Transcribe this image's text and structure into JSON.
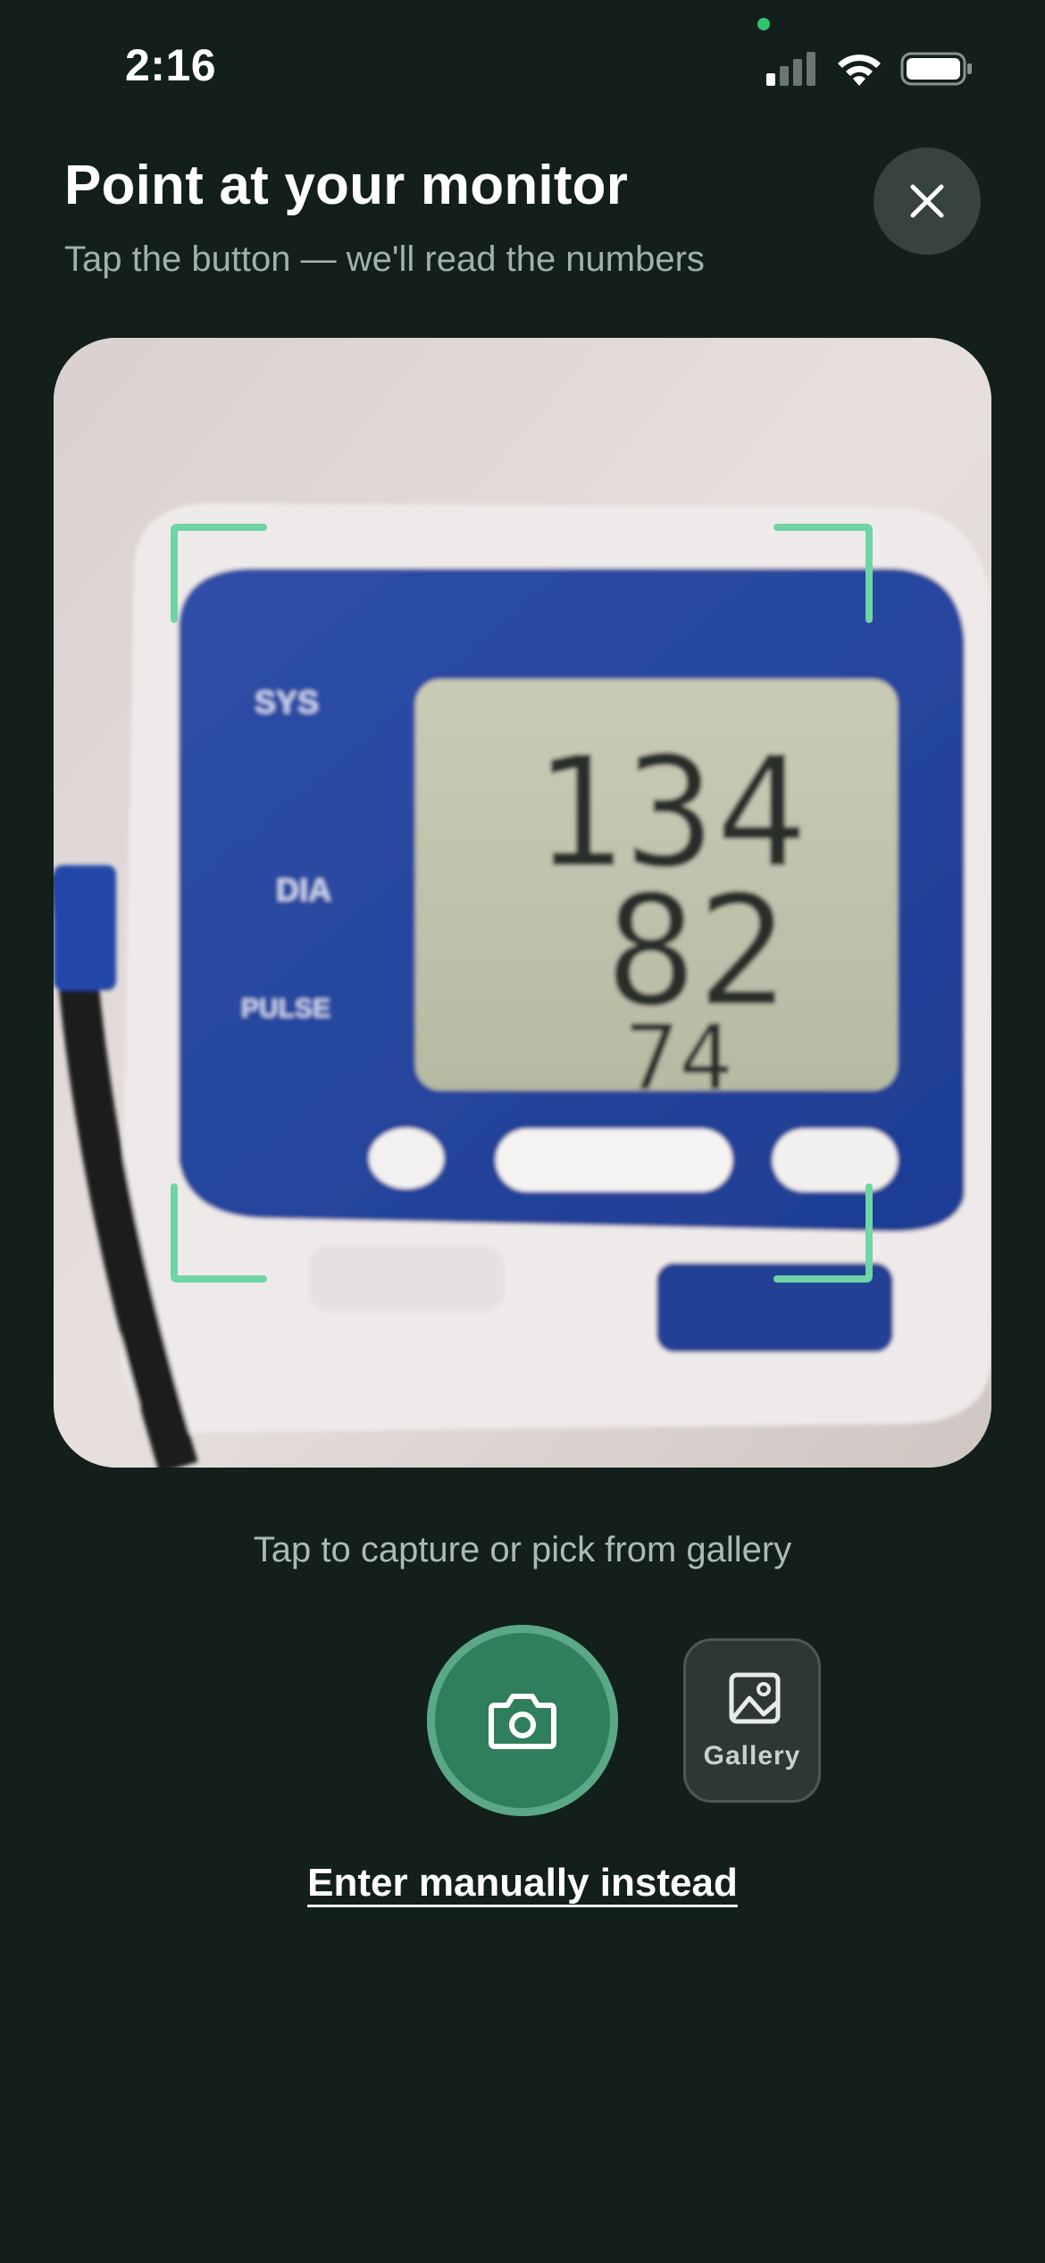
{
  "status_bar": {
    "time": "2:16",
    "icons": [
      "signal-icon",
      "wifi-icon",
      "battery-icon"
    ]
  },
  "header": {
    "title": "Point at your monitor",
    "subtitle": "Tap the button — we'll read the numbers",
    "close_icon": "close-icon"
  },
  "viewfinder": {
    "monitor_labels": [
      "SYS",
      "DIA",
      "PULSE"
    ],
    "readings": {
      "systolic": "134",
      "diastolic": "82",
      "pulse": "74"
    },
    "frame_color": "#6fd4a6"
  },
  "capture": {
    "hint": "Tap to capture or pick from gallery",
    "shutter_icon": "camera-icon",
    "gallery_icon": "image-icon",
    "gallery_label": "Gallery",
    "manual_link": "Enter manually instead"
  },
  "colors": {
    "background": "#121f1b",
    "accent": "#2f7f5c",
    "accent_ring": "#5aa886"
  }
}
